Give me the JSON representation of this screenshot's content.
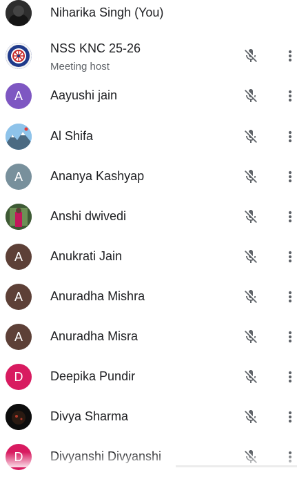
{
  "participants": [
    {
      "name": "Niharika Singh (You)",
      "subtitle": "",
      "avatar_type": "photo",
      "avatar_letter": "",
      "avatar_color": "#3b3b3b",
      "muted": false,
      "show_controls": false
    },
    {
      "name": "NSS KNC 25-26",
      "subtitle": "Meeting host",
      "avatar_type": "logo",
      "avatar_letter": "",
      "avatar_color": "#1f3a8a",
      "muted": true,
      "show_controls": true
    },
    {
      "name": "Aayushi jain",
      "subtitle": "",
      "avatar_type": "letter",
      "avatar_letter": "A",
      "avatar_color": "#7e57c2",
      "muted": true,
      "show_controls": true
    },
    {
      "name": "Al Shifa",
      "subtitle": "",
      "avatar_type": "photo",
      "avatar_letter": "",
      "avatar_color": "#6fa8dc",
      "muted": true,
      "show_controls": true
    },
    {
      "name": "Ananya Kashyap",
      "subtitle": "",
      "avatar_type": "letter",
      "avatar_letter": "A",
      "avatar_color": "#78909c",
      "muted": true,
      "show_controls": true
    },
    {
      "name": "Anshi dwivedi",
      "subtitle": "",
      "avatar_type": "photo",
      "avatar_letter": "",
      "avatar_color": "#4d6b3c",
      "muted": true,
      "show_controls": true
    },
    {
      "name": "Anukrati Jain",
      "subtitle": "",
      "avatar_type": "letter",
      "avatar_letter": "A",
      "avatar_color": "#5d4037",
      "muted": true,
      "show_controls": true
    },
    {
      "name": "Anuradha Mishra",
      "subtitle": "",
      "avatar_type": "letter",
      "avatar_letter": "A",
      "avatar_color": "#5d4037",
      "muted": true,
      "show_controls": true
    },
    {
      "name": "Anuradha Misra",
      "subtitle": "",
      "avatar_type": "letter",
      "avatar_letter": "A",
      "avatar_color": "#5d4037",
      "muted": true,
      "show_controls": true
    },
    {
      "name": "Deepika Pundir",
      "subtitle": "",
      "avatar_type": "letter",
      "avatar_letter": "D",
      "avatar_color": "#d81b60",
      "muted": true,
      "show_controls": true
    },
    {
      "name": "Divya Sharma",
      "subtitle": "",
      "avatar_type": "photo",
      "avatar_letter": "",
      "avatar_color": "#111111",
      "muted": true,
      "show_controls": true
    },
    {
      "name": "Divyanshi Divyanshi",
      "subtitle": "",
      "avatar_type": "letter",
      "avatar_letter": "D",
      "avatar_color": "#d81b60",
      "muted": true,
      "show_controls": true
    }
  ],
  "icons": {
    "mic_off": "mic-off-icon",
    "more": "more-vert-icon"
  },
  "colors": {
    "icon_gray": "#5f6368",
    "text": "#202124",
    "subtext": "#5f6368"
  }
}
